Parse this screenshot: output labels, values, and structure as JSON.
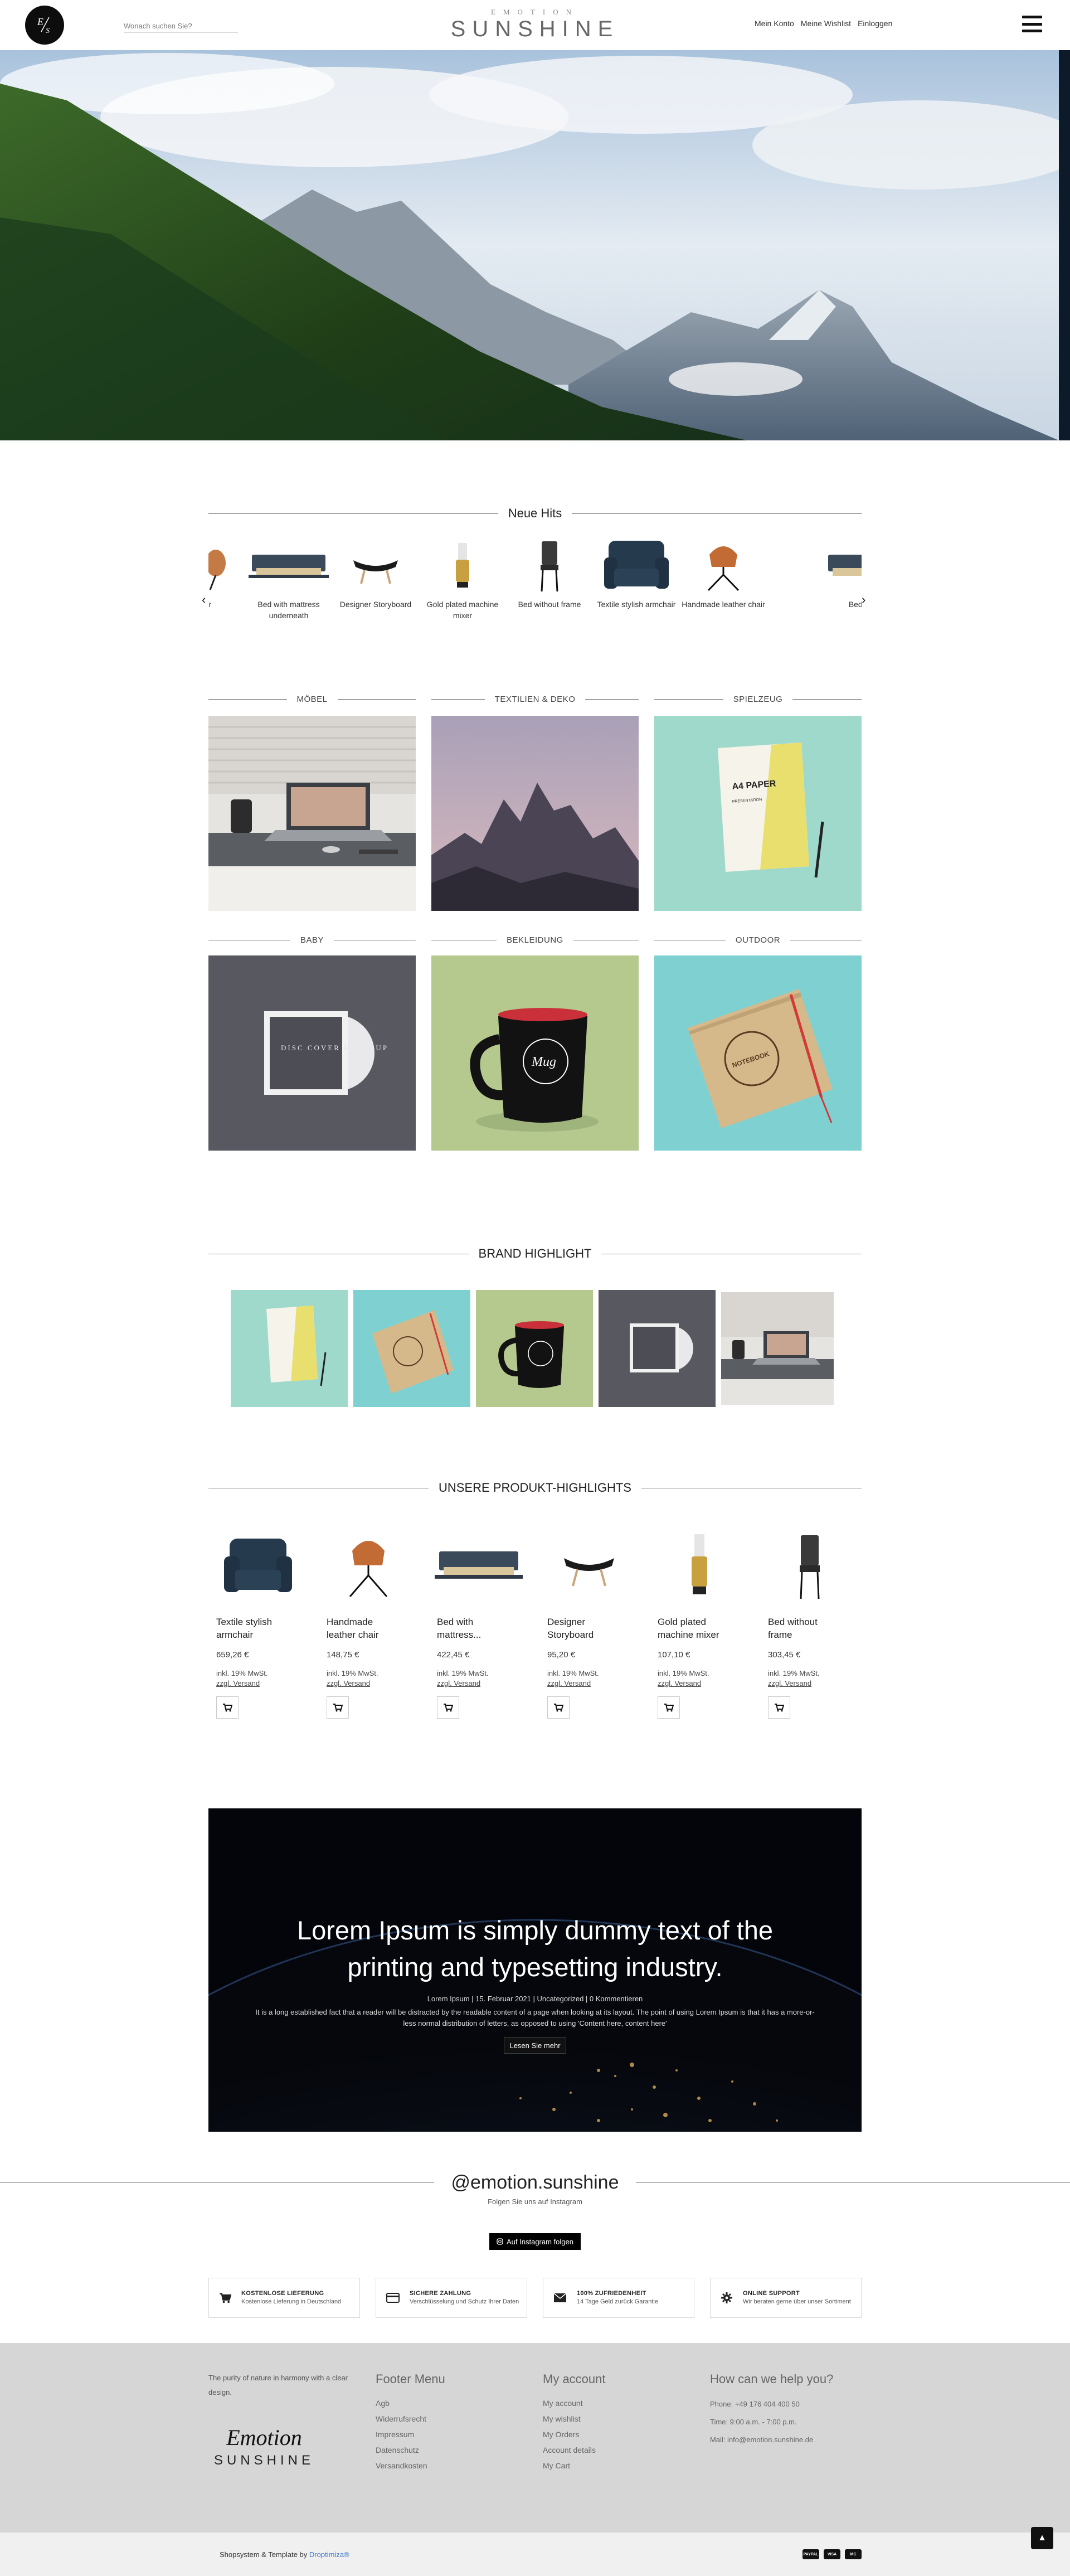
{
  "header": {
    "logo_alt": "E/S",
    "search_placeholder": "Wonach suchen Sie?",
    "brand_top": "EMOTION",
    "brand_main": "SUNSHINE",
    "links": [
      "Mein Konto",
      "Meine Wishlist",
      "Einloggen"
    ]
  },
  "neue_hits": {
    "title": "Neue Hits",
    "items": [
      {
        "name": "her chair"
      },
      {
        "name": "Bed with mattress underneath"
      },
      {
        "name": "Designer Storyboard"
      },
      {
        "name": "Gold plated machine mixer"
      },
      {
        "name": "Bed without frame"
      },
      {
        "name": "Textile stylish armchair"
      },
      {
        "name": "Handmade leather chair"
      },
      {
        "name": "Bed w un"
      }
    ],
    "prev_arrow": "‹",
    "next_arrow": "›"
  },
  "categories": [
    {
      "label": "MÖBEL"
    },
    {
      "label": "TEXTILIEN & DEKO"
    },
    {
      "label": "SPIELZEUG"
    },
    {
      "label": "BABY"
    },
    {
      "label": "BEKLEIDUNG"
    },
    {
      "label": "OUTDOOR"
    }
  ],
  "category_art": {
    "a4_title": "A4 PAPER",
    "a4_sub": "PRESENTATION",
    "disc_text": "DISC COVER MOCK UP",
    "mug_text": "Mug",
    "book_text": "NOTEBOOK"
  },
  "brand_highlight": {
    "title": "BRAND HIGHLIGHT"
  },
  "products": {
    "title": "UNSERE PRODUKT-HIGHLIGHTS",
    "tax": "inkl. 19% MwSt.",
    "shipping": "zzgl. Versand",
    "items": [
      {
        "name_line1": "Textile stylish",
        "name_line2": "armchair",
        "price": "659,26 €"
      },
      {
        "name_line1": "Handmade",
        "name_line2": "leather chair",
        "price": "148,75 €"
      },
      {
        "name_line1": "Bed with",
        "name_line2": "mattress...",
        "price": "422,45 €"
      },
      {
        "name_line1": "Designer",
        "name_line2": "Storyboard",
        "price": "95,20 €"
      },
      {
        "name_line1": "Gold plated",
        "name_line2": "machine mixer",
        "price": "107,10 €"
      },
      {
        "name_line1": "Bed without",
        "name_line2": "frame",
        "price": "303,45 €"
      }
    ]
  },
  "blog": {
    "title": "Lorem Ipsum is simply dummy text of the printing and typesetting industry.",
    "meta": "Lorem Ipsum | 15. Februar 2021 | Uncategorized | 0 Kommentieren",
    "excerpt": "It is a long established fact that a reader will be distracted by the readable content of a page when looking at its layout. The point of using Lorem Ipsum is that it has a more-or-less normal distribution of letters, as opposed to using 'Content here, content here'",
    "button": "Lesen Sie mehr"
  },
  "instagram": {
    "handle": "@emotion.sunshine",
    "subtitle": "Folgen Sie uns auf Instagram",
    "button": "Auf Instagram folgen"
  },
  "features": [
    {
      "title": "KOSTENLOSE LIEFERUNG",
      "desc": "Kostenlose Lieferung in Deutschland",
      "icon": "cart-icon"
    },
    {
      "title": "SICHERE ZAHLUNG",
      "desc": "Verschlüsselung und Schutz Ihrer Daten",
      "icon": "card-icon"
    },
    {
      "title": "100% ZUFRIEDENHEIT",
      "desc": "14 Tage Geld zurück Garantie",
      "icon": "mail-icon"
    },
    {
      "title": "ONLINE SUPPORT",
      "desc": "Wir beraten gerne über unser Sortiment",
      "icon": "gear-icon"
    }
  ],
  "footer": {
    "tagline": "The purity of nature in harmony with a clear design.",
    "logo_script": "Emotion",
    "logo_sun": "SUNSHINE",
    "menu": {
      "title": "Footer Menu",
      "items": [
        "Agb",
        "Widerrufsrecht",
        "Impressum",
        "Datenschutz",
        "Versandkosten"
      ]
    },
    "account": {
      "title": "My account",
      "items": [
        "My account",
        "My wishlist",
        "My Orders",
        "Account details",
        "My Cart"
      ]
    },
    "help": {
      "title": "How can we help you?",
      "phone": "Phone: +49 176 404 400 50",
      "time": "Time: 9:00 a.m. - 7:00 p.m.",
      "mail": "Mail: info@emotion.sunshine.de"
    },
    "credit_prefix": "Shopsystem & Template by",
    "credit_link": "Droptimiza®",
    "payments": [
      "PAYPAL",
      "VISA",
      "MC"
    ],
    "to_top": "▲"
  },
  "colors": {
    "accent_link": "#3b78c4",
    "footer_bg": "#d6d6d6",
    "bottom_bg": "#f0f0f0"
  }
}
